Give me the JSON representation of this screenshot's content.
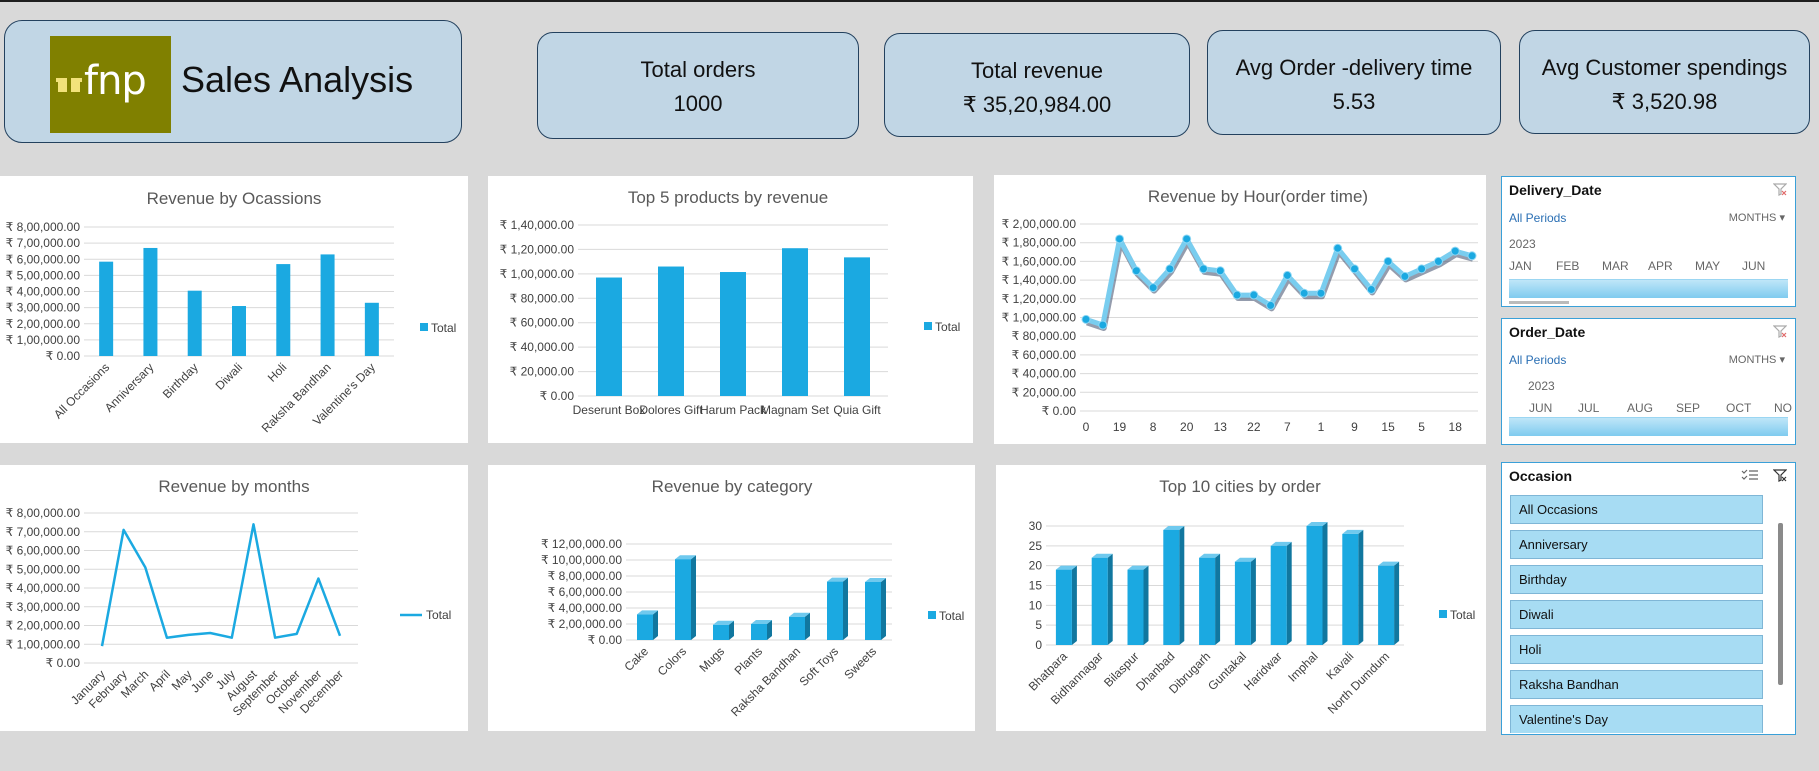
{
  "header": {
    "logo_text": "fnp",
    "title": "Sales Analysis"
  },
  "kpis": [
    {
      "label": "Total orders",
      "value": "1000"
    },
    {
      "label": "Total revenue",
      "value": "₹ 35,20,984.00"
    },
    {
      "label": "Avg Order -delivery time",
      "value": "5.53"
    },
    {
      "label": "Avg Customer spendings",
      "value": "₹ 3,520.98"
    }
  ],
  "colors": {
    "bar": "#1ba9e1",
    "bar_dark": "#11779f",
    "card": "#c1d6e5",
    "card_border": "#23415e"
  },
  "charts": {
    "occasions": {
      "type": "bar",
      "title": "Revenue by Ocassions",
      "legend": "Total",
      "yticks": [
        "₹ 0.00",
        "₹ 1,00,000.00",
        "₹ 2,00,000.00",
        "₹ 3,00,000.00",
        "₹ 4,00,000.00",
        "₹ 5,00,000.00",
        "₹ 6,00,000.00",
        "₹ 7,00,000.00",
        "₹ 8,00,000.00"
      ],
      "ylim": [
        0,
        800000
      ],
      "categories": [
        "All Occasions",
        "Anniversary",
        "Birthday",
        "Diwali",
        "Holi",
        "Raksha Bandhan",
        "Valentine's Day"
      ],
      "values": [
        585000,
        670000,
        405000,
        310000,
        570000,
        630000,
        330000
      ]
    },
    "top_products": {
      "type": "bar",
      "title": "Top 5 products by revenue",
      "legend": "Total",
      "yticks": [
        "₹ 0.00",
        "₹ 20,000.00",
        "₹ 40,000.00",
        "₹ 60,000.00",
        "₹ 80,000.00",
        "₹ 1,00,000.00",
        "₹ 1,20,000.00",
        "₹ 1,40,000.00"
      ],
      "ylim": [
        0,
        140000
      ],
      "categories": [
        "Deserunt Box",
        "Dolores Gift",
        "Harum Pack",
        "Magnam Set",
        "Quia Gift"
      ],
      "values": [
        97000,
        106000,
        101500,
        121000,
        113500
      ]
    },
    "hours": {
      "type": "line",
      "title": "Revenue by Hour(order time)",
      "yticks": [
        "₹ 0.00",
        "₹ 20,000.00",
        "₹ 40,000.00",
        "₹ 60,000.00",
        "₹ 80,000.00",
        "₹ 1,00,000.00",
        "₹ 1,20,000.00",
        "₹ 1,40,000.00",
        "₹ 1,60,000.00",
        "₹ 1,80,000.00",
        "₹ 2,00,000.00"
      ],
      "ylim": [
        0,
        200000
      ],
      "categories": [
        "0",
        "19",
        "8",
        "20",
        "13",
        "22",
        "7",
        "1",
        "9",
        "15",
        "5",
        "18"
      ],
      "values": [
        98000,
        92000,
        184000,
        150000,
        132000,
        152000,
        184000,
        152000,
        150000,
        124000,
        124000,
        113000,
        145000,
        126000,
        126000,
        174000,
        152000,
        130000,
        160000,
        144000,
        152000,
        160000,
        171000,
        166000
      ]
    },
    "months": {
      "type": "line",
      "title": "Revenue by months",
      "legend": "Total",
      "yticks": [
        "₹ 0.00",
        "₹ 1,00,000.00",
        "₹ 2,00,000.00",
        "₹ 3,00,000.00",
        "₹ 4,00,000.00",
        "₹ 5,00,000.00",
        "₹ 6,00,000.00",
        "₹ 7,00,000.00",
        "₹ 8,00,000.00"
      ],
      "ylim": [
        0,
        800000
      ],
      "categories": [
        "January",
        "February",
        "March",
        "April",
        "May",
        "June",
        "July",
        "August",
        "September",
        "October",
        "November",
        "December"
      ],
      "values": [
        90000,
        710000,
        510000,
        135000,
        150000,
        160000,
        135000,
        740000,
        135000,
        155000,
        450000,
        145000
      ]
    },
    "category": {
      "type": "bar",
      "title": "Revenue by category",
      "legend": "Total",
      "yticks": [
        "₹ 0.00",
        "₹ 2,00,000.00",
        "₹ 4,00,000.00",
        "₹ 6,00,000.00",
        "₹ 8,00,000.00",
        "₹ 10,00,000.00",
        "₹ 12,00,000.00"
      ],
      "ylim": [
        0,
        1200000
      ],
      "categories": [
        "Cake",
        "Colors",
        "Mugs",
        "Plants",
        "Raksha Bandhan",
        "Soft Toys",
        "Sweets"
      ],
      "values": [
        320000,
        1010000,
        190000,
        200000,
        290000,
        730000,
        725000
      ]
    },
    "cities": {
      "type": "bar",
      "title": "Top 10 cities by order",
      "legend": "Total",
      "yticks": [
        "0",
        "5",
        "10",
        "15",
        "20",
        "25",
        "30"
      ],
      "ylim": [
        0,
        30
      ],
      "categories": [
        "Bhatpara",
        "Bidhannagar",
        "Bilaspur",
        "Dhanbad",
        "Dibrugarh",
        "Guntakal",
        "Haridwar",
        "Imphal",
        "Kavali",
        "North Dumdum"
      ],
      "values": [
        19,
        22,
        19,
        29,
        22,
        21,
        25,
        30,
        28,
        20
      ]
    }
  },
  "slicers": {
    "delivery": {
      "title": "Delivery_Date",
      "all_periods": "All Periods",
      "unit": "MONTHS",
      "year": "2023",
      "months": [
        "JAN",
        "FEB",
        "MAR",
        "APR",
        "MAY",
        "JUN"
      ]
    },
    "order": {
      "title": "Order_Date",
      "all_periods": "All Periods",
      "unit": "MONTHS",
      "year": "2023",
      "months": [
        "JUN",
        "JUL",
        "AUG",
        "SEP",
        "OCT",
        "NOV"
      ]
    },
    "occasion": {
      "title": "Occasion",
      "items": [
        "All Occasions",
        "Anniversary",
        "Birthday",
        "Diwali",
        "Holi",
        "Raksha Bandhan",
        "Valentine's Day"
      ]
    }
  }
}
